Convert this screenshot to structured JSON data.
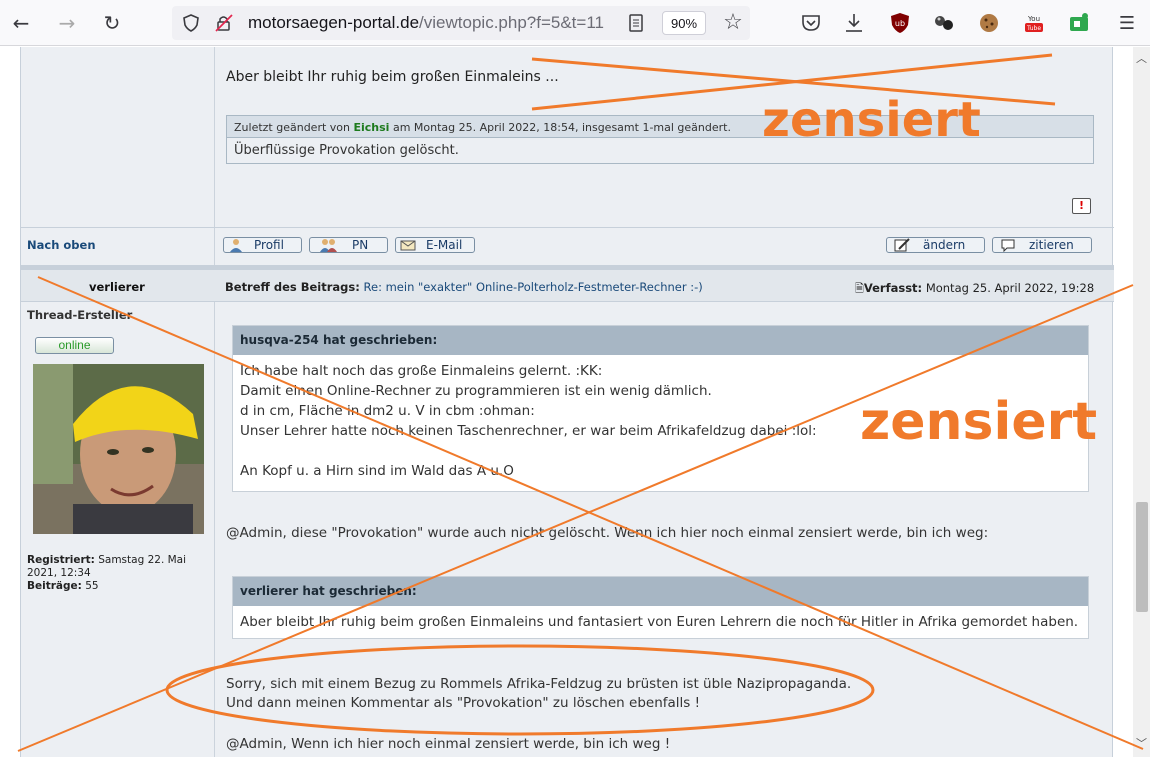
{
  "browser": {
    "url_domain": "motorsaegen-portal.de",
    "url_rest": "/viewtopic.php?f=5&t=11",
    "zoom": "90%"
  },
  "post1": {
    "text_line": "Aber bleibt Ihr ruhig beim großen Einmaleins ...",
    "edit_prefix": "Zuletzt geändert von",
    "edit_user": "Eichsi",
    "edit_suffix": "am Montag 25. April 2022, 18:54, insgesamt 1-mal geändert.",
    "edit_reason": "Überflüssige Provokation gelöscht.",
    "report_icon": "!",
    "nach_oben": "Nach oben",
    "btn_profil": "Profil",
    "btn_pn": "PN",
    "btn_email": "E-Mail",
    "btn_aendern": "ändern",
    "btn_zitieren": "zitieren"
  },
  "post2": {
    "author": "verlierer",
    "rank": "Thread-Ersteller",
    "online_label": "online",
    "subject_label": "Betreff des Beitrags:",
    "subject": "Re: mein \"exakter\" Online-Polterholz-Festmeter-Rechner :-)",
    "posted_label": "Verfasst:",
    "posted_date": "Montag 25. April 2022, 19:28",
    "registered_label": "Registriert:",
    "registered_value": "Samstag 22. Mai",
    "registered_value2": "2021, 12:34",
    "posts_label": "Beiträge:",
    "posts_value": "55",
    "quote1_head": "husqva-254 hat geschrieben:",
    "quote1_lines": [
      "Ich habe halt noch das große Einmaleins gelernt. :KK:",
      "Damit einen Online-Rechner zu programmieren ist ein wenig dämlich.",
      "d in cm, Fläche in dm2 u. V in cbm :ohman:",
      "Unser Lehrer hatte noch keinen Taschenrechner, er war beim Afrikafeldzug dabei :lol:",
      "",
      "An Kopf u. a Hirn sind im Wald das A u.O"
    ],
    "line_admin1": "@Admin, diese \"Provokation\" wurde auch nicht gelöscht. Wenn ich hier noch einmal zensiert werde, bin ich weg:",
    "quote2_head": "verlierer hat geschrieben:",
    "quote2_text": "Aber bleibt Ihr ruhig beim großen Einmaleins und fantasiert von Euren Lehrern die noch für Hitler in Afrika gemordet haben.",
    "sorry_line1": "Sorry, sich mit einem Bezug zu Rommels Afrika-Feldzug zu brüsten ist üble Nazipropaganda.",
    "sorry_line2": "Und dann meinen Kommentar als \"Provokation\" zu löschen ebenfalls !",
    "admin_line2": "@Admin, Wenn ich hier noch einmal zensiert werde, bin ich weg !"
  },
  "overlay": {
    "stamp1": "zensiert",
    "stamp2": "zensiert",
    "color": "#f07a2b"
  }
}
